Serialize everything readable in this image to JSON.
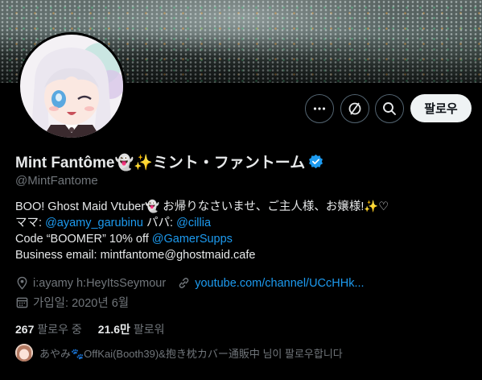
{
  "profile": {
    "display_name": "Mint Fantôme👻✨ミント・ファントーム",
    "handle": "@MintFantome",
    "bio": {
      "line1": "BOO! Ghost Maid Vtuber👻 お帰りなさいませ、ご主人様、お嬢様!✨♡",
      "line2_prefix": "ママ: ",
      "line2_link1": "@ayamy_garubinu",
      "line2_mid": " パパ: ",
      "line2_link2": "@cillia",
      "line3_prefix": "Code “BOOMER” 10% off ",
      "line3_link": "@GamerSupps",
      "line4": "Business email: mintfantome@ghostmaid.cafe"
    },
    "location": "i:ayamy h:HeyItsSeymour",
    "website": "youtube.com/channel/UCcHHk...",
    "joined": "가입일: 2020년 6월"
  },
  "stats": {
    "following_count": "267",
    "following_label": "팔로우 중",
    "followers_count": "21.6만",
    "followers_label": "팔로워"
  },
  "followed_by": {
    "text": "あやみ🐾OffKai(Booth39)&抱き枕カバー通販中 님이 팔로우합니다"
  },
  "actions": {
    "follow_label": "팔로우",
    "more_icon": "more-horizontal-icon",
    "subscribe_icon": "subscribe-icon",
    "search_icon": "search-icon"
  },
  "colors": {
    "background": "#000000",
    "link": "#1d9bf0",
    "secondary_text": "#71767b",
    "follow_button_bg": "#eff3f4"
  }
}
